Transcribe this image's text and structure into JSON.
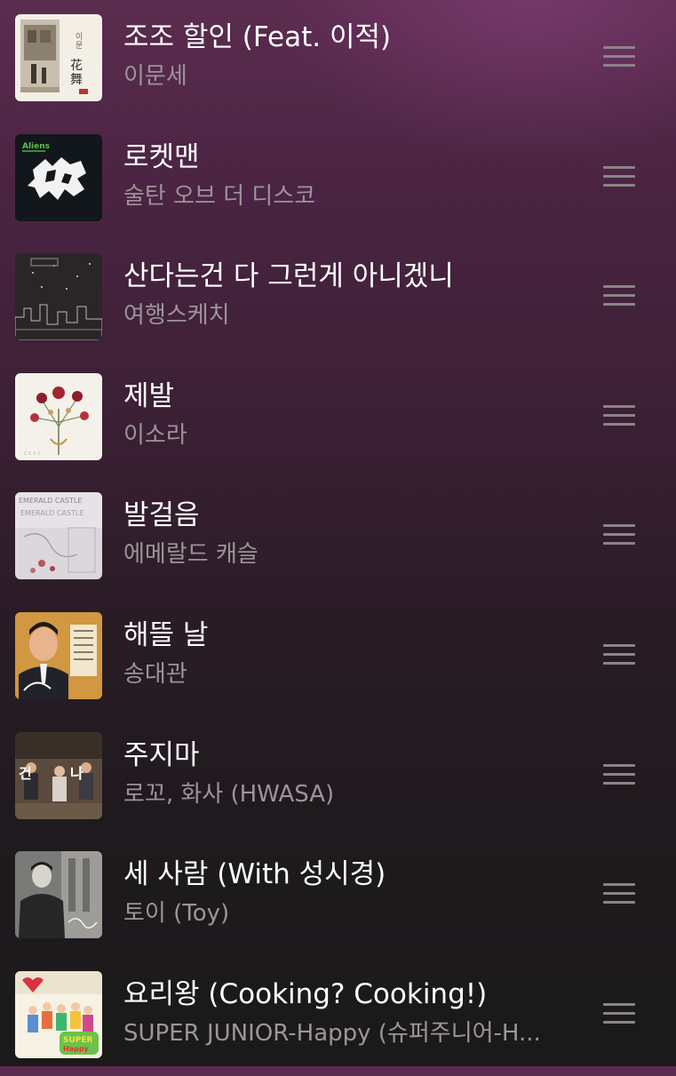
{
  "playlist": {
    "tracks": [
      {
        "title": "조조 할인 (Feat. 이적)",
        "artist": "이문세",
        "cover_icon": "album-art-hwamu"
      },
      {
        "title": "로켓맨",
        "artist": "술탄 오브 더 디스코",
        "cover_icon": "album-art-aliens"
      },
      {
        "title": "산다는건 다 그런게 아니겠니",
        "artist": "여행스케치",
        "cover_icon": "album-art-night-city"
      },
      {
        "title": "제발",
        "artist": "이소라",
        "cover_icon": "album-art-flowers"
      },
      {
        "title": "발걸음",
        "artist": "에메랄드 캐슬",
        "cover_icon": "album-art-emerald-castle"
      },
      {
        "title": "해뜰 날",
        "artist": "송대관",
        "cover_icon": "album-art-portrait"
      },
      {
        "title": "주지마",
        "artist": "로꼬, 화사 (HWASA)",
        "cover_icon": "album-art-group"
      },
      {
        "title": "세 사람 (With 성시경)",
        "artist": "토이 (Toy)",
        "cover_icon": "album-art-bw-portrait"
      },
      {
        "title": "요리왕 (Cooking? Cooking!)",
        "artist": "SUPER JUNIOR-Happy (슈퍼주니어-H...",
        "cover_icon": "album-art-super-junior-happy"
      }
    ],
    "drag_handle_icon": "drag-handle-icon"
  },
  "colors": {
    "title_text": "#ffffff",
    "artist_text": "#9d949a",
    "handle": "#8a8488",
    "background_top": "#5b2c4e",
    "background_bottom": "#1a1a1a"
  }
}
